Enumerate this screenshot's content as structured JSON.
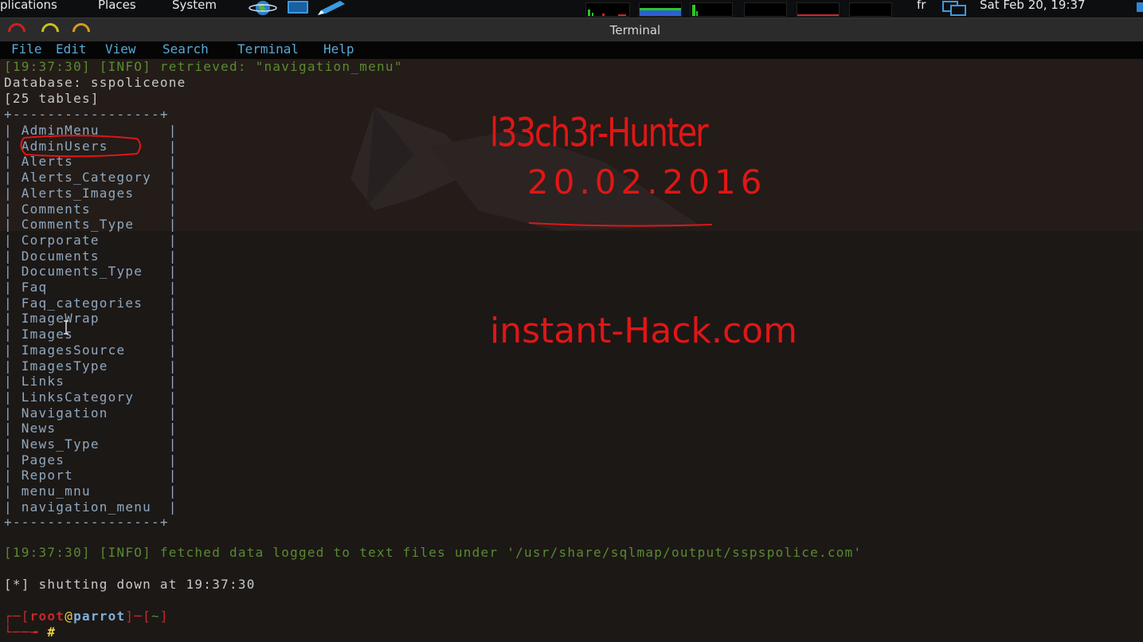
{
  "top_panel": {
    "applications": "plications",
    "places": "Places",
    "system": "System",
    "keyboard_layout": "fr",
    "clock": "Sat Feb 20, 19:37"
  },
  "window": {
    "title": "Terminal"
  },
  "menubar": {
    "items": [
      "File",
      "Edit",
      "View",
      "Search",
      "Terminal",
      "Help"
    ]
  },
  "terminal": {
    "retrieved_line": "[19:37:30] [INFO] retrieved: \"navigation_menu\"",
    "database_line": "Database: sspoliceone",
    "count_line": "[25 tables]",
    "border": "+-----------------+",
    "tables": [
      "AdminMenu",
      "AdminUsers",
      "Alerts",
      "Alerts_Category",
      "Alerts_Images",
      "Comments",
      "Comments_Type",
      "Corporate",
      "Documents",
      "Documents_Type",
      "Faq",
      "Faq_categories",
      "ImageWrap",
      "Images",
      "ImagesSource",
      "ImagesType",
      "Links",
      "LinksCategory",
      "Navigation",
      "News",
      "News_Type",
      "Pages",
      "Report",
      "menu_mnu",
      "navigation_menu"
    ],
    "fetched_line": "[19:37:30] [INFO] fetched data logged to text files under '/usr/share/sqlmap/output/sspspolice.com'",
    "shutdown_line": "[*] shutting down at 19:37:30",
    "prompt": {
      "open": "┌─[",
      "user": "root",
      "at": "@",
      "host": "parrot",
      "mid": "]─[",
      "dir": "~",
      "close": "]",
      "line2": "└──╼ ",
      "symbol": "#"
    }
  },
  "annotations": {
    "author": "l33ch3r-Hunter",
    "date": "20.02.2016",
    "site": "instant-Hack.com"
  },
  "colors": {
    "info_green": "#5a8a30",
    "menu_blue": "#58a9d6",
    "prompt_red": "#c82828",
    "prompt_yellow": "#e8d040",
    "annotation_red": "#e01616"
  }
}
